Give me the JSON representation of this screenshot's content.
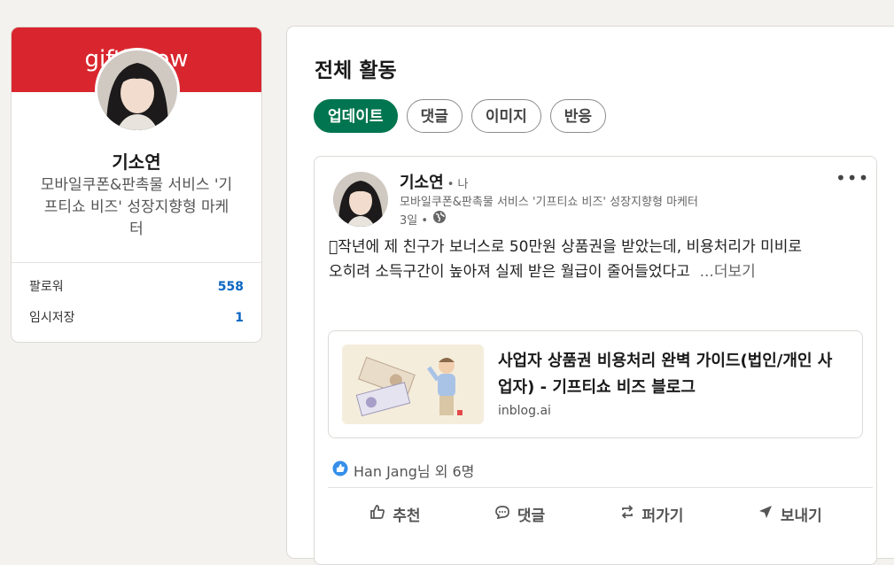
{
  "profile": {
    "banner_text": "giftishow",
    "name": "기소연",
    "headline": "모바일쿠폰&판촉물 서비스 '기프티쇼 비즈' 성장지향형 마케터",
    "stats": [
      {
        "label": "팔로워",
        "value": "558"
      },
      {
        "label": "임시저장",
        "value": "1"
      }
    ]
  },
  "activity": {
    "title": "전체 활동",
    "filters": [
      "업데이트",
      "댓글",
      "이미지",
      "반응"
    ],
    "active_filter": "업데이트"
  },
  "post": {
    "author": "기소연",
    "degree": "• 나",
    "headline": "모바일쿠폰&판촉물 서비스 '기프티쇼 비즈' 성장지향형 마케터",
    "time": "3일 •",
    "text_line1": "􀀀작년에 제 친구가 보너스로 50만원 상품권을 받았는데, 비용처리가 미비로",
    "text_line2": "오히려 소득구간이 높아져 실제 받은 월급이 줄어들었다고",
    "see_more": "...더보기",
    "link_title": "사업자 상품권 비용처리 완벽 가이드(법인/개인 사업자) - 기프티쇼 비즈 블로그",
    "link_domain": "inblog.ai",
    "reactions_text": "Han Jang님 외 6명",
    "actions": [
      "추천",
      "댓글",
      "퍼가기",
      "보내기"
    ]
  },
  "colors": {
    "banner": "#d9262e",
    "accent_green": "#01754f",
    "link_blue": "#0a66c2"
  }
}
